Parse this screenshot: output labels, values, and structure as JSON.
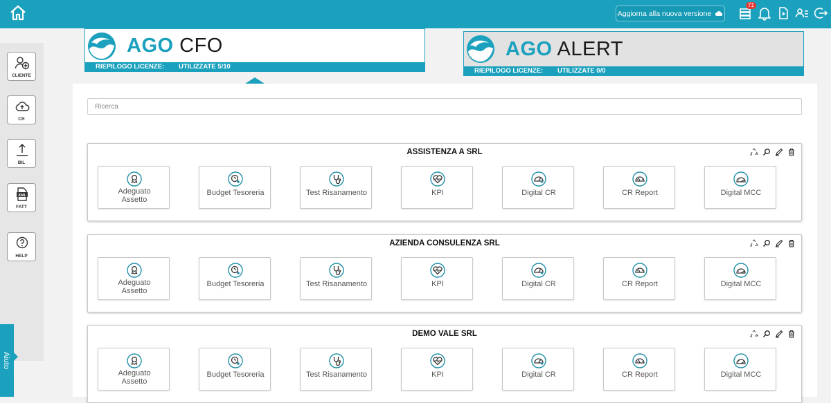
{
  "header": {
    "update_label": "Aggiorna alla nuova versione",
    "notification_count": "71"
  },
  "sidebar": {
    "items": [
      {
        "label": "CLIENTE"
      },
      {
        "label": "CR"
      },
      {
        "label": "BIL"
      },
      {
        "label": "FATT"
      },
      {
        "label": "HELP"
      }
    ],
    "help_tab": "Aiuto"
  },
  "products": {
    "cfo": {
      "brand": "AGO",
      "name": "CFO",
      "licenze_label": "RIEPILOGO LICENZE:",
      "licenze_value": "UTILIZZATE 5/10"
    },
    "alert": {
      "brand": "AGO",
      "name": "ALERT",
      "licenze_label": "RIEPILOGO LICENZE:",
      "licenze_value": "UTILIZZATE 0/0"
    }
  },
  "search": {
    "placeholder": "Ricerca"
  },
  "tiles": {
    "adeguato_1": "Adeguato",
    "adeguato_2": "Assetto",
    "budget": "Budget Tesoreria",
    "test": "Test Risanamento",
    "kpi": "KPI",
    "digital_cr": "Digital CR",
    "cr_report": "CR Report",
    "digital_mcc": "Digital MCC"
  },
  "companies": [
    {
      "name": "ASSISTENZA A SRL"
    },
    {
      "name": "AZIENDA CONSULENZA SRL"
    },
    {
      "name": "DEMO VALE SRL"
    }
  ],
  "colors": {
    "accent": "#1ba1bd",
    "tile_icon": "#1f8fa8"
  }
}
